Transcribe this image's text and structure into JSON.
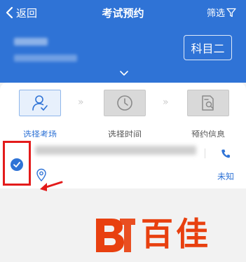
{
  "header": {
    "back_label": "返回",
    "title": "考试预约",
    "filter_label": "筛选",
    "subject_label": "科目二"
  },
  "steps": [
    {
      "label": "选择考场",
      "icon": "user-check-icon",
      "state": "active"
    },
    {
      "label": "选择时间",
      "icon": "clock-icon",
      "state": "inactive"
    },
    {
      "label": "预约信息",
      "icon": "document-search-icon",
      "state": "inactive"
    }
  ],
  "venue_item": {
    "selected": true,
    "status_text": "未知"
  },
  "watermark": {
    "text": "百佳"
  },
  "colors": {
    "primary": "#2f73d6",
    "highlight": "#e31b1b",
    "watermark": "#e8400f"
  }
}
